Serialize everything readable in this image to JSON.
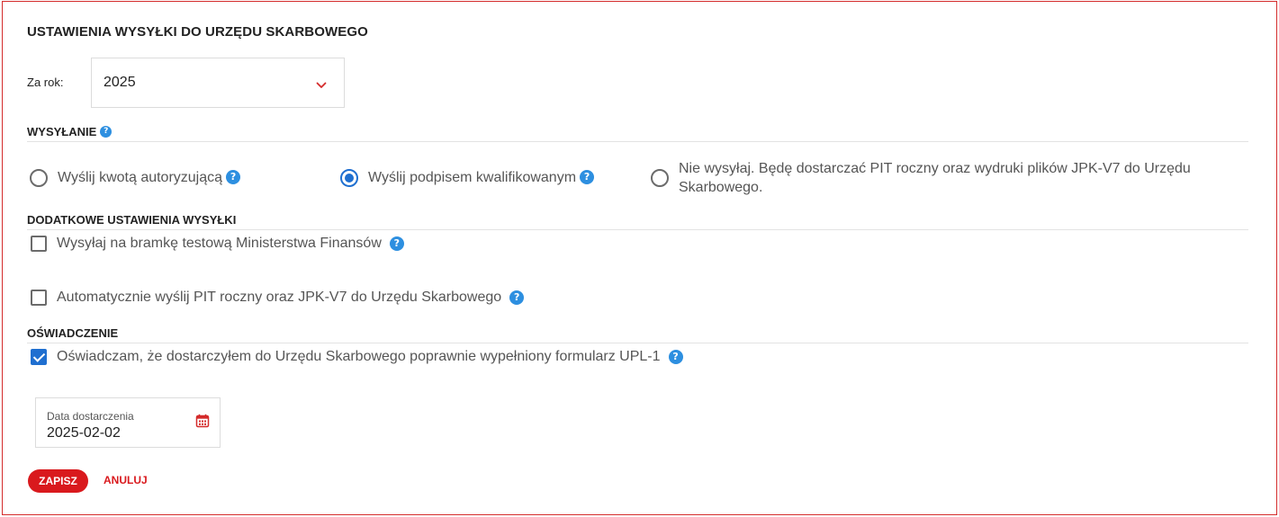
{
  "header": {
    "title": "USTAWIENIA WYSYŁKI DO URZĘDU SKARBOWEGO"
  },
  "year": {
    "label": "Za rok:",
    "selected": "2025"
  },
  "sending": {
    "title": "WYSYŁANIE",
    "options": [
      {
        "label": "Wyślij kwotą autoryzującą",
        "checked": false
      },
      {
        "label": "Wyślij podpisem kwalifikowanym",
        "checked": true
      },
      {
        "label_line1": "Nie wysyłaj. Będę dostarczać PIT roczny oraz wydruki plików JPK-V7 do Urzędu",
        "label_line2": "Skarbowego.",
        "checked": false
      }
    ]
  },
  "additional": {
    "title": "DODATKOWE USTAWIENIA WYSYŁKI",
    "options": [
      {
        "label": "Wysyłaj na bramkę testową Ministerstwa Finansów",
        "checked": false
      },
      {
        "label": "Automatycznie wyślij PIT roczny oraz JPK-V7 do Urzędu Skarbowego",
        "checked": false
      }
    ]
  },
  "declaration": {
    "title": "OŚWIADCZENIE",
    "option": {
      "label": "Oświadczam, że dostarczyłem do Urzędu Skarbowego poprawnie wypełniony formularz UPL-1",
      "checked": true
    },
    "date_field": {
      "label": "Data dostarczenia",
      "value": "2025-02-02"
    }
  },
  "actions": {
    "save_label": "ZAPISZ",
    "cancel_label": "ANULUJ"
  },
  "icons": {
    "help": "question-mark-icon",
    "calendar": "calendar-icon",
    "dropdown": "chevron-down-icon"
  },
  "colors": {
    "accent_red": "#d9191d",
    "check_blue": "#1f6fd0",
    "help_blue": "#2d8fe0"
  }
}
